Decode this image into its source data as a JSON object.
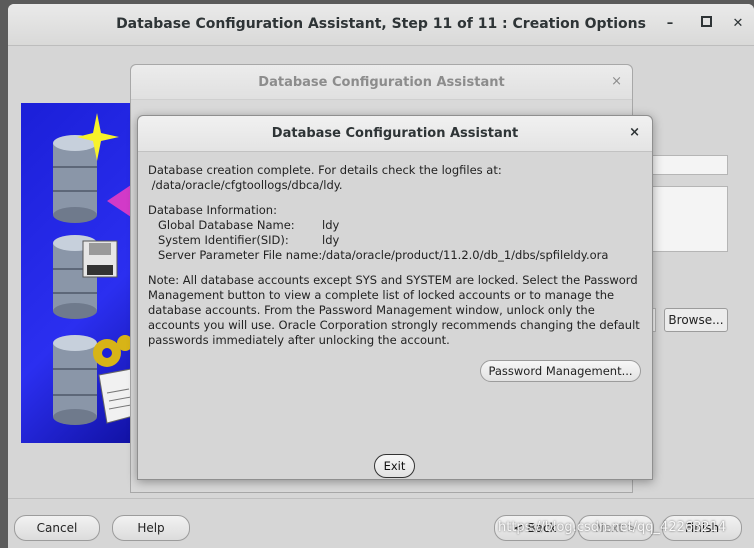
{
  "main_window": {
    "title": "Database Configuration Assistant, Step 11 of 11 : Creation Options",
    "min_icon": "minimize-icon",
    "max_icon": "maximize-icon",
    "close_icon": "close-icon"
  },
  "bottom_bar": {
    "cancel": "Cancel",
    "help": "Help",
    "back": "Back",
    "next": "Next",
    "finish": "Finish"
  },
  "background_panel": {
    "browse": "Browse..."
  },
  "bg_dialog": {
    "title": "Database Configuration Assistant",
    "close": "×"
  },
  "dialog": {
    "title": "Database Configuration Assistant",
    "close": "×",
    "completion_line1": "Database creation complete. For details check the logfiles at:",
    "completion_line2": " /data/oracle/cfgtoollogs/dbca/ldy.",
    "info_header": "Database Information:",
    "info_rows": [
      {
        "label": "Global Database Name:",
        "value": "ldy"
      },
      {
        "label": "System Identifier(SID):",
        "value": "ldy"
      },
      {
        "label": "Server Parameter File name:",
        "value": "/data/oracle/product/11.2.0/db_1/dbs/spfileldy.ora"
      }
    ],
    "note_lines": [
      "Note: All database accounts except SYS and SYSTEM are locked. Select the Password",
      "Management button to view a complete list of locked accounts or to manage the",
      "database accounts. From the Password Management window, unlock only the",
      "accounts you will use. Oracle Corporation strongly recommends changing the default",
      "passwords immediately after unlocking the account."
    ],
    "password_button": "Password Management...",
    "exit_button": "Exit"
  },
  "watermark": "https://blog.csdn.net/qq_42263214",
  "colors": {
    "wizard_image_blue": "#2b2ff0",
    "window_bg": "#d6d6d6"
  }
}
